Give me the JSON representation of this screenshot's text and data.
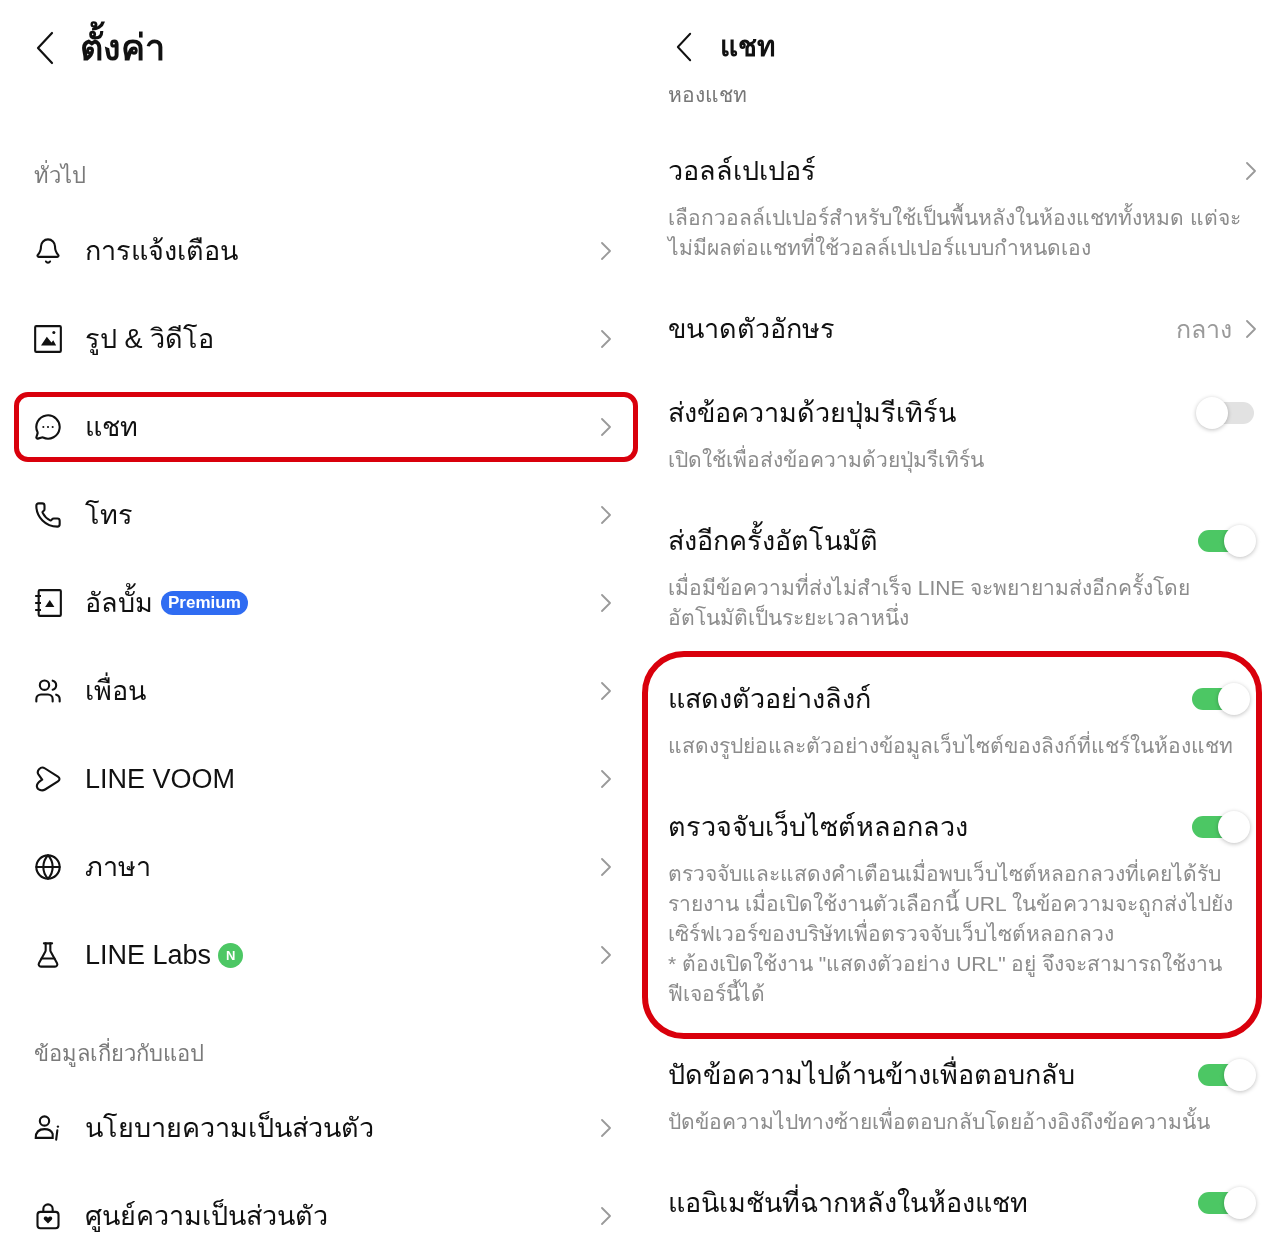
{
  "left": {
    "header": {
      "title": "ตั้งค่า"
    },
    "sections": [
      {
        "label": "ทั่วไป",
        "items": [
          {
            "label": "การแจ้งเตือน",
            "highlighted": false
          },
          {
            "label": "รูป & วิดีโอ",
            "highlighted": false
          },
          {
            "label": "แชท",
            "highlighted": true
          },
          {
            "label": "โทร",
            "highlighted": false
          },
          {
            "label": "อัลบั้ม",
            "highlighted": false,
            "badge": {
              "kind": "pill",
              "text": "Premium"
            }
          },
          {
            "label": "เพื่อน",
            "highlighted": false
          },
          {
            "label": "LINE VOOM",
            "highlighted": false
          },
          {
            "label": "ภาษา",
            "highlighted": false
          },
          {
            "label": "LINE Labs",
            "highlighted": false,
            "badge": {
              "kind": "dot",
              "text": "N"
            }
          }
        ]
      },
      {
        "label": "ข้อมูลเกี่ยวกับแอป",
        "items": [
          {
            "label": "นโยบายความเป็นส่วนตัว",
            "highlighted": false
          },
          {
            "label": "ศูนย์ความเป็นส่วนตัว",
            "highlighted": false
          }
        ]
      }
    ]
  },
  "right": {
    "header": {
      "title": "แชท"
    },
    "section_label": "หองแชท",
    "items": [
      {
        "kind": "link",
        "title": "วอลล์เปเปอร์",
        "description": "เลือกวอลล์เปเปอร์สำหรับใช้เป็นพื้นหลังในห้องแชททั้งหมด แต่จะไม่มีผลต่อแชทที่ใช้วอลล์เปเปอร์แบบกำหนดเอง",
        "highlighted": false
      },
      {
        "kind": "link",
        "title": "ขนาดตัวอักษร",
        "value": "กลาง",
        "highlighted": false
      },
      {
        "kind": "toggle",
        "title": "ส่งข้อความด้วยปุ่มรีเทิร์น",
        "on": false,
        "description": "เปิดใช้เพื่อส่งข้อความด้วยปุ่มรีเทิร์น",
        "highlighted": false
      },
      {
        "kind": "toggle",
        "title": "ส่งอีกครั้งอัตโนมัติ",
        "on": true,
        "description": "เมื่อมีข้อความที่ส่งไม่สำเร็จ LINE จะพยายามส่งอีกครั้งโดยอัตโนมัติเป็นระยะเวลาหนึ่ง",
        "highlighted": false
      },
      {
        "kind": "toggle",
        "title": "แสดงตัวอย่างลิงก์",
        "on": true,
        "description": "แสดงรูปย่อและตัวอย่างข้อมูลเว็บไซต์ของลิงก์ที่แชร์ในห้องแชท",
        "highlighted": true
      },
      {
        "kind": "toggle",
        "title": "ตรวจจับเว็บไซต์หลอกลวง",
        "on": true,
        "description": "ตรวจจับและแสดงคำเตือนเมื่อพบเว็บไซต์หลอกลวงที่เคยได้รับรายงาน เมื่อเปิดใช้งานตัวเลือกนี้ URL ในข้อความจะถูกส่งไปยังเซิร์ฟเวอร์ของบริษัทเพื่อตรวจจับเว็บไซต์หลอกลวง",
        "note": "* ต้องเปิดใช้งาน \"แสดงตัวอย่าง URL\" อยู่ จึงจะสามารถใช้งานฟีเจอร์นี้ได้",
        "highlighted": true
      },
      {
        "kind": "toggle",
        "title": "ปัดข้อความไปด้านข้างเพื่อตอบกลับ",
        "on": true,
        "description": "ปัดข้อความไปทางซ้ายเพื่อตอบกลับโดยอ้างอิงถึงข้อความนั้น",
        "highlighted": false
      },
      {
        "kind": "toggle",
        "title": "แอนิเมชันที่ฉากหลังในห้องแชท",
        "on": true,
        "highlighted": false
      }
    ]
  }
}
